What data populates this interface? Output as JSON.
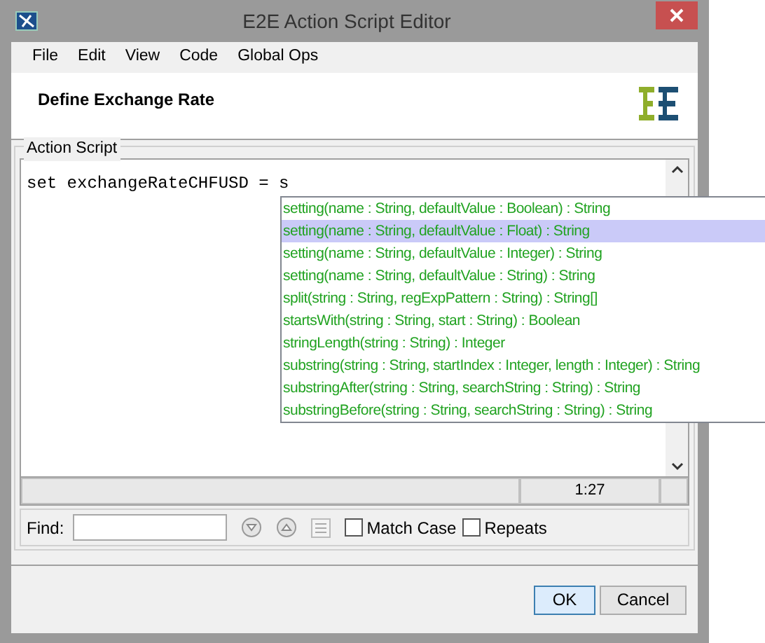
{
  "window": {
    "title": "E2E Action Script Editor"
  },
  "menu": [
    "File",
    "Edit",
    "View",
    "Code",
    "Global Ops"
  ],
  "header": {
    "title": "Define Exchange Rate"
  },
  "script": {
    "legend": "Action Script",
    "code": "set exchangeRateCHFUSD = s"
  },
  "autocomplete": [
    {
      "text": "setting(name : String, defaultValue : Boolean) : String",
      "selected": false
    },
    {
      "text": "setting(name : String, defaultValue : Float) : String",
      "selected": true
    },
    {
      "text": "setting(name : String, defaultValue : Integer) : String",
      "selected": false
    },
    {
      "text": "setting(name : String, defaultValue : String) : String",
      "selected": false
    },
    {
      "text": "split(string : String, regExpPattern : String) : String[]",
      "selected": false
    },
    {
      "text": "startsWith(string : String, start : String) : Boolean",
      "selected": false
    },
    {
      "text": "stringLength(string : String) : Integer",
      "selected": false
    },
    {
      "text": "substring(string : String, startIndex : Integer, length : Integer) : String",
      "selected": false
    },
    {
      "text": "substringAfter(string : String, searchString : String) : String",
      "selected": false
    },
    {
      "text": "substringBefore(string : String, searchString : String) : String",
      "selected": false
    }
  ],
  "status_bar": {
    "position": "1:27"
  },
  "find": {
    "label": "Find:",
    "options": [
      {
        "label": "Match Case",
        "checked": false
      },
      {
        "label": "Repeats",
        "checked": false
      }
    ]
  },
  "buttons": [
    {
      "label": "OK",
      "default": true
    },
    {
      "label": "Cancel",
      "default": false
    }
  ]
}
